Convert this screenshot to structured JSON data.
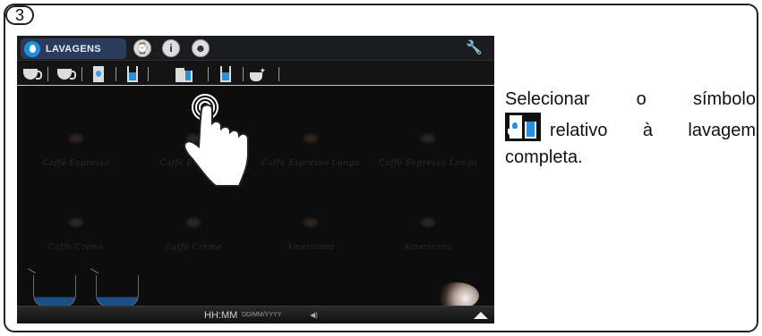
{
  "step": {
    "number": "3"
  },
  "topbar": {
    "active_tab": {
      "label": "LAVAGENS",
      "icon": "water-drop-icon"
    },
    "icons": [
      "clock-icon",
      "info-icon",
      "user-icon",
      "wrench-icon"
    ]
  },
  "toolbar": {
    "icons": [
      "cup-rinse-icon",
      "cup-icon",
      "milk-carton-icon",
      "glass-icon",
      "full-rinse-icon",
      "glass-icon",
      "steam-cup-icon"
    ]
  },
  "drinks": {
    "row1": [
      "Caffè Espresso",
      "Caffè Espresso",
      "Caffè Espresso Lungo",
      "Caffè Espresso Lungo"
    ],
    "row2": [
      "Caffè Crème",
      "Caffè Crème",
      "Americano",
      "Americano"
    ]
  },
  "bottombar": {
    "time": "HH:MM",
    "date": "DD/MM/YYYY",
    "speaker_icon": "speaker-icon",
    "arrow_icon": "up-arrow-icon"
  },
  "caption": {
    "line1": "Selecionar o símbolo",
    "line2_suffix": "relativo à lavagem completa.",
    "symbol": "full-rinse-icon"
  }
}
